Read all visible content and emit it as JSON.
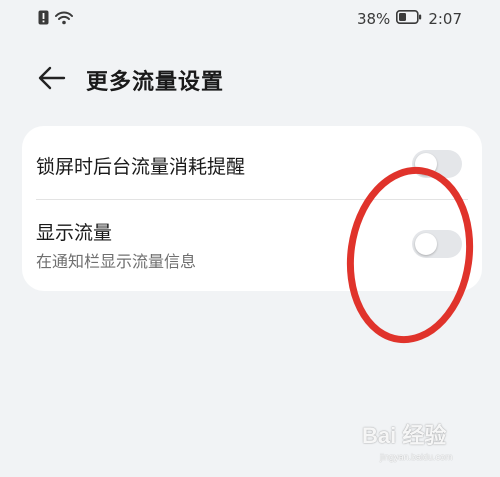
{
  "status_bar": {
    "battery_percent": "38%",
    "time": "2:07",
    "icons": [
      "sim-alert-icon",
      "wifi-icon",
      "battery-icon"
    ]
  },
  "header": {
    "back_icon": "arrow-left-icon",
    "title": "更多流量设置"
  },
  "settings": {
    "items": [
      {
        "title": "锁屏时后台流量消耗提醒",
        "subtitle": "",
        "toggle_on": false
      },
      {
        "title": "显示流量",
        "subtitle": "在通知栏显示流量信息",
        "toggle_on": false
      }
    ]
  },
  "annotation": {
    "color": "#e0332b"
  },
  "watermark": {
    "brand": "Bai 经验",
    "site": "jingyan.baidu.com"
  },
  "colors": {
    "background": "#f1f3f5",
    "card": "#ffffff",
    "toggle_off": "#e4e6e9"
  }
}
